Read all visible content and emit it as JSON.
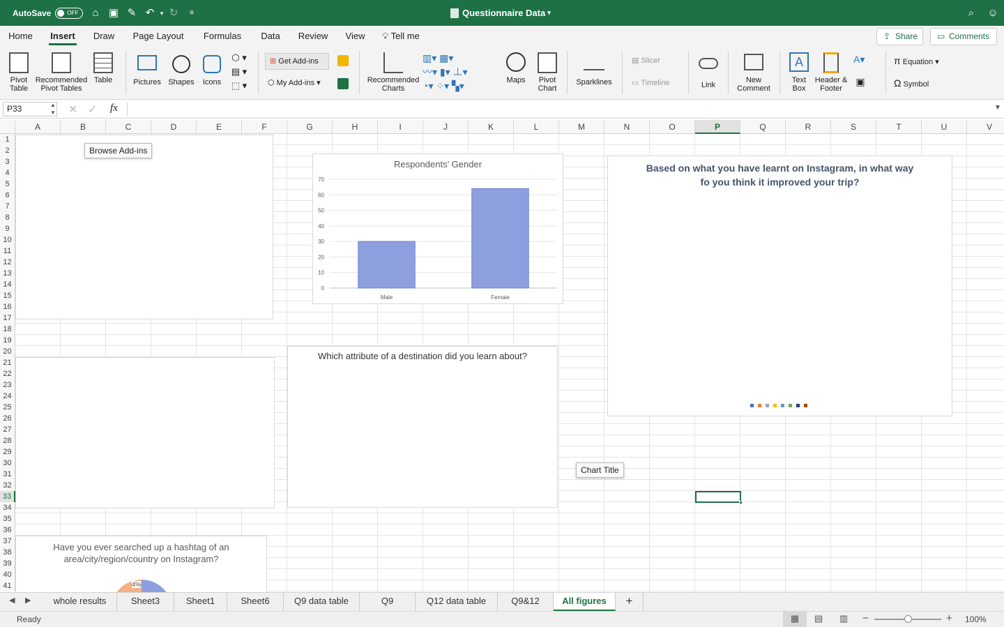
{
  "app": {
    "autosave_label": "AutoSave",
    "autosave_state": "OFF",
    "doc_title": "Questionnaire Data",
    "accent": "#1e7145"
  },
  "menu": {
    "tabs": [
      "Home",
      "Insert",
      "Draw",
      "Page Layout",
      "Formulas",
      "Data",
      "Review",
      "View"
    ],
    "tell_me": "Tell me",
    "share": "Share",
    "comments": "Comments"
  },
  "ribbon": {
    "pivot_table": [
      "Pivot",
      "Table"
    ],
    "rec_pivot": [
      "Recommended",
      "Pivot Tables"
    ],
    "table": "Table",
    "pictures": "Pictures",
    "shapes": "Shapes",
    "icons": "Icons",
    "get_addins": "Get Add-ins",
    "my_addins": "My Add-ins",
    "rec_charts": [
      "Recommended",
      "Charts"
    ],
    "maps": "Maps",
    "pivot_chart": [
      "Pivot",
      "Chart"
    ],
    "sparklines": "Sparklines",
    "slicer": "Slicer",
    "timeline": "Timeline",
    "link": "Link",
    "new_comment": [
      "New",
      "Comment"
    ],
    "text_box": [
      "Text",
      "Box"
    ],
    "header_footer": [
      "Header &",
      "Footer"
    ],
    "equation": "Equation",
    "symbol": "Symbol"
  },
  "formula": {
    "name_box": "P33",
    "fx": "fx",
    "value": ""
  },
  "grid": {
    "columns": [
      "A",
      "B",
      "C",
      "D",
      "E",
      "F",
      "G",
      "H",
      "I",
      "J",
      "K",
      "L",
      "M",
      "N",
      "O",
      "P",
      "Q",
      "R",
      "S",
      "T",
      "U",
      "V"
    ],
    "rows": [
      "1",
      "2",
      "3",
      "4",
      "5",
      "6",
      "7",
      "8",
      "9",
      "10",
      "11",
      "12",
      "13",
      "14",
      "15",
      "16",
      "17",
      "18",
      "19",
      "20",
      "21",
      "22",
      "23",
      "24",
      "25",
      "26",
      "27",
      "28",
      "29",
      "30",
      "31",
      "32",
      "33",
      "34",
      "35",
      "36",
      "37",
      "38",
      "39",
      "40",
      "41"
    ],
    "selected_cell": "P33"
  },
  "tooltips": {
    "browse_addins": "Browse Add-ins",
    "chart_title": "Chart Title"
  },
  "charts": {
    "gender_title": "Respondents' Gender",
    "instagram_title_line1": "Based on  what you have learnt on Instagram, in what way",
    "instagram_title_line2": "fo you think it improved your trip?",
    "attribute_title": "Which attribute of a destination did you learn about?",
    "hashtag_title_line1": "Have you ever searched up a hashtag of an",
    "hashtag_title_line2": "area/city/region/country on Instagram?",
    "hashtag_pct_label": "4%",
    "legend_colors": [
      "#4472c4",
      "#ed7d31",
      "#a5a5a5",
      "#ffc000",
      "#5b9bd5",
      "#70ad47",
      "#264478",
      "#9e480e"
    ]
  },
  "chart_data": {
    "type": "bar",
    "title": "Respondents' Gender",
    "categories": [
      "Male",
      "Female"
    ],
    "values": [
      30,
      64
    ],
    "ylim": [
      0,
      70
    ],
    "yticks": [
      "0",
      "10",
      "20",
      "30",
      "40",
      "50",
      "60",
      "70"
    ],
    "xlabel": "",
    "ylabel": "",
    "grid": true,
    "bar_color": "#8e9fdf"
  },
  "sheets": {
    "tabs": [
      "whole results",
      "Sheet3",
      "Sheet1",
      "Sheet6",
      "Q9 data table",
      "Q9",
      "Q12 data table",
      "Q9&12",
      "All figures"
    ],
    "active": "All figures",
    "add": "+"
  },
  "status": {
    "ready": "Ready",
    "zoom": "100%",
    "zoom_level": 1.0
  }
}
